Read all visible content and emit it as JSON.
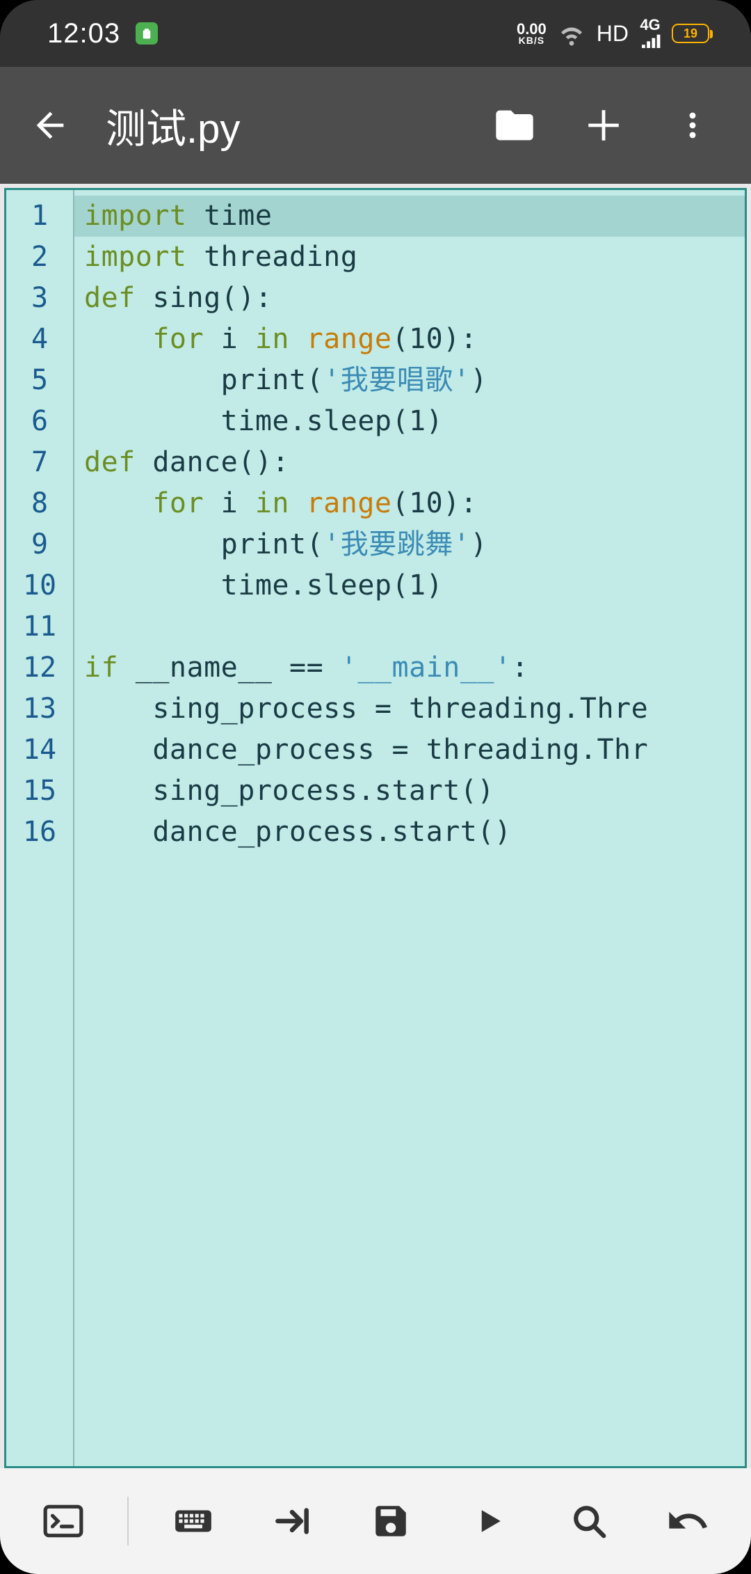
{
  "statusbar": {
    "time": "12:03",
    "net_speed_top": "0.00",
    "net_speed_bottom": "KB/S",
    "hd": "HD",
    "sig_top": "4G",
    "battery_pct": "19"
  },
  "appbar": {
    "title": "测试.py"
  },
  "editor": {
    "line_numbers": [
      "1",
      "2",
      "3",
      "4",
      "5",
      "6",
      "7",
      "8",
      "9",
      "10",
      "11",
      "12",
      "13",
      "14",
      "15",
      "16"
    ],
    "lines": [
      {
        "highlight": true,
        "tokens": [
          {
            "cls": "kw",
            "text": "import"
          },
          {
            "cls": "plain",
            "text": " time"
          }
        ]
      },
      {
        "highlight": false,
        "tokens": [
          {
            "cls": "kw",
            "text": "import"
          },
          {
            "cls": "plain",
            "text": " threading"
          }
        ]
      },
      {
        "highlight": false,
        "tokens": [
          {
            "cls": "kw",
            "text": "def"
          },
          {
            "cls": "plain",
            "text": " sing():"
          }
        ]
      },
      {
        "highlight": false,
        "tokens": [
          {
            "cls": "plain",
            "text": "    "
          },
          {
            "cls": "kw",
            "text": "for"
          },
          {
            "cls": "plain",
            "text": " i "
          },
          {
            "cls": "kw",
            "text": "in"
          },
          {
            "cls": "plain",
            "text": " "
          },
          {
            "cls": "fn",
            "text": "range"
          },
          {
            "cls": "plain",
            "text": "(10):"
          }
        ]
      },
      {
        "highlight": false,
        "tokens": [
          {
            "cls": "plain",
            "text": "        print("
          },
          {
            "cls": "str",
            "text": "'我要唱歌'"
          },
          {
            "cls": "plain",
            "text": ")"
          }
        ]
      },
      {
        "highlight": false,
        "tokens": [
          {
            "cls": "plain",
            "text": "        time.sleep(1)"
          }
        ]
      },
      {
        "highlight": false,
        "tokens": [
          {
            "cls": "kw",
            "text": "def"
          },
          {
            "cls": "plain",
            "text": " dance():"
          }
        ]
      },
      {
        "highlight": false,
        "tokens": [
          {
            "cls": "plain",
            "text": "    "
          },
          {
            "cls": "kw",
            "text": "for"
          },
          {
            "cls": "plain",
            "text": " i "
          },
          {
            "cls": "kw",
            "text": "in"
          },
          {
            "cls": "plain",
            "text": " "
          },
          {
            "cls": "fn",
            "text": "range"
          },
          {
            "cls": "plain",
            "text": "(10):"
          }
        ]
      },
      {
        "highlight": false,
        "tokens": [
          {
            "cls": "plain",
            "text": "        print("
          },
          {
            "cls": "str",
            "text": "'我要跳舞'"
          },
          {
            "cls": "plain",
            "text": ")"
          }
        ]
      },
      {
        "highlight": false,
        "tokens": [
          {
            "cls": "plain",
            "text": "        time.sleep(1)"
          }
        ]
      },
      {
        "highlight": false,
        "tokens": [
          {
            "cls": "plain",
            "text": ""
          }
        ]
      },
      {
        "highlight": false,
        "tokens": [
          {
            "cls": "kw",
            "text": "if"
          },
          {
            "cls": "plain",
            "text": " __name__ == "
          },
          {
            "cls": "str",
            "text": "'__main__'"
          },
          {
            "cls": "plain",
            "text": ":"
          }
        ]
      },
      {
        "highlight": false,
        "tokens": [
          {
            "cls": "plain",
            "text": "    sing_process = threading.Thre"
          }
        ]
      },
      {
        "highlight": false,
        "tokens": [
          {
            "cls": "plain",
            "text": "    dance_process = threading.Thr"
          }
        ]
      },
      {
        "highlight": false,
        "tokens": [
          {
            "cls": "plain",
            "text": "    sing_process.start()"
          }
        ]
      },
      {
        "highlight": false,
        "tokens": [
          {
            "cls": "plain",
            "text": "    dance_process.start()"
          }
        ]
      }
    ]
  },
  "icons": {
    "back": "back-arrow-icon",
    "folder": "folder-icon",
    "add": "add-icon",
    "more": "more-vert-icon",
    "terminal": "terminal-icon",
    "keyboard": "keyboard-icon",
    "tab": "tab-indent-icon",
    "save": "save-icon",
    "run": "play-icon",
    "search": "search-icon",
    "undo": "undo-icon"
  }
}
